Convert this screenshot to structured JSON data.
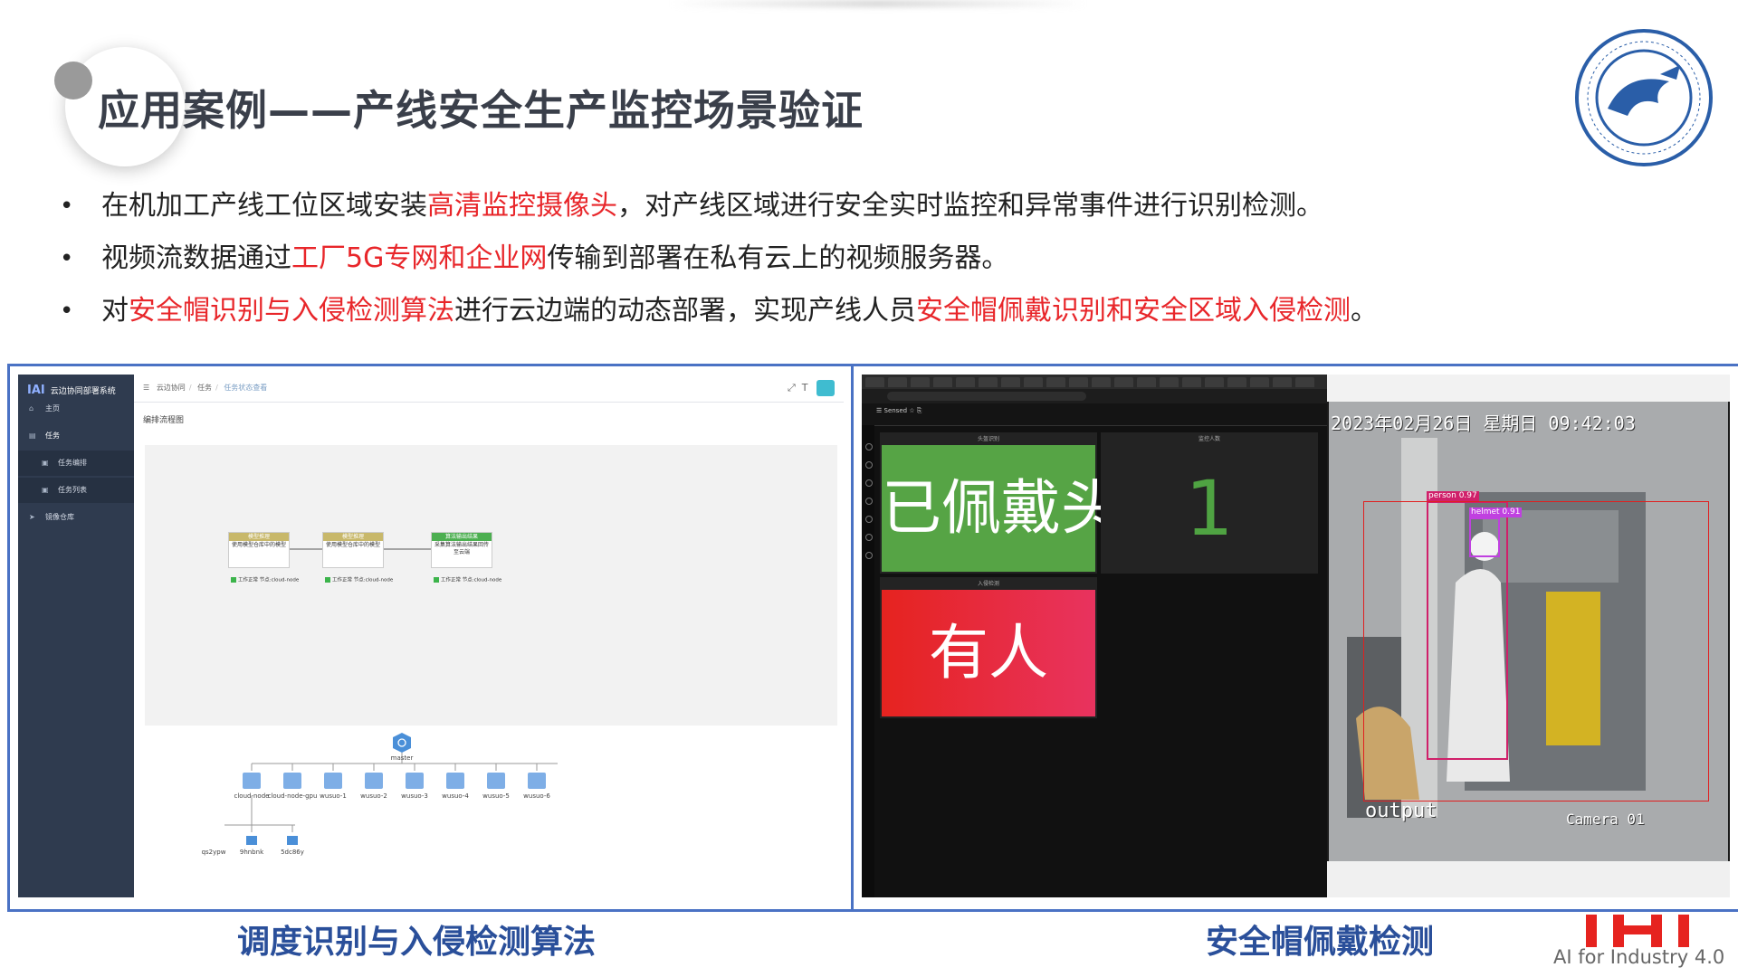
{
  "title": "应用案例——产线安全生产监控场景验证",
  "bullets": [
    {
      "parts": [
        {
          "t": "在机加工产线工位区域安装",
          "red": false
        },
        {
          "t": "高清监控摄像头",
          "red": true
        },
        {
          "t": "，对产线区域进行安全实时监控和异常事件进行识别检测。",
          "red": false
        }
      ]
    },
    {
      "parts": [
        {
          "t": "视频流数据通过",
          "red": false
        },
        {
          "t": "工厂5G专网和企业网",
          "red": true
        },
        {
          "t": "传输到部署在私有云上的视频服务器。",
          "red": false
        }
      ]
    },
    {
      "parts": [
        {
          "t": "对",
          "red": false
        },
        {
          "t": "安全帽识别与入侵检测算法",
          "red": true
        },
        {
          "t": "进行云边端的动态部署，实现产线人员",
          "red": false
        },
        {
          "t": "安全帽佩戴识别和安全区域入侵检测",
          "red": true
        },
        {
          "t": "。",
          "red": false
        }
      ]
    }
  ],
  "left_app": {
    "brand_logo": "IAI",
    "brand_name": "云边协同部署系统",
    "nav": [
      {
        "label": "主页",
        "icon": "home-icon"
      },
      {
        "label": "任务",
        "icon": "task-icon",
        "active": true
      },
      {
        "label": "任务编排",
        "icon": "doc-icon",
        "sub": true
      },
      {
        "label": "任务列表",
        "icon": "list-icon",
        "sub": true
      },
      {
        "label": "镜像仓库",
        "icon": "send-icon"
      }
    ],
    "breadcrumb": [
      "云边协同",
      "任务",
      "任务状态查看"
    ],
    "subtitle": "编排流程图",
    "flow_nodes": [
      {
        "head": "模型推理",
        "body": "使用模型仓库中的模型",
        "footer1": "工作正常",
        "footer2": "节点:cloud-node",
        "color": "#c8b86a"
      },
      {
        "head": "模型推理",
        "body": "使用模型仓库中的模型",
        "footer1": "工作正常",
        "footer2": "节点:cloud-node",
        "color": "#c8b86a"
      },
      {
        "head": "算法输出结果",
        "body": "采集算法输出结果回传至云端",
        "footer1": "工作正常",
        "footer2": "节点:cloud-node",
        "color": "#4caf50"
      }
    ],
    "master": "master",
    "edge_nodes": [
      "cloud-node",
      "cloud-node-gpu",
      "wusuo-1",
      "wusuo-2",
      "wusuo-3",
      "wusuo-4",
      "wusuo-5",
      "wusuo-6"
    ],
    "pods": [
      "qs2ypw",
      "9hnbnk",
      "5dc86y"
    ]
  },
  "right_app": {
    "panel_a_title": "头盔识别",
    "panel_a_value": "已佩戴头盔",
    "panel_b_title": "监控人数",
    "panel_b_value": "1",
    "panel_c_title": "入侵检测",
    "panel_c_value": "有人",
    "timestamp": "2023年02月26日  星期日  09:42:03",
    "det_person": "person 0.97",
    "det_helmet": "helmet 0.91",
    "output_label": "output",
    "camera_label": "Camera 01",
    "colors": {
      "green": "#56a445",
      "red": "#e6231f"
    }
  },
  "captions": {
    "left": "调度识别与入侵检测算法",
    "right": "安全帽佩戴检测"
  },
  "footer_logo_text": "AI for Industry 4.0"
}
